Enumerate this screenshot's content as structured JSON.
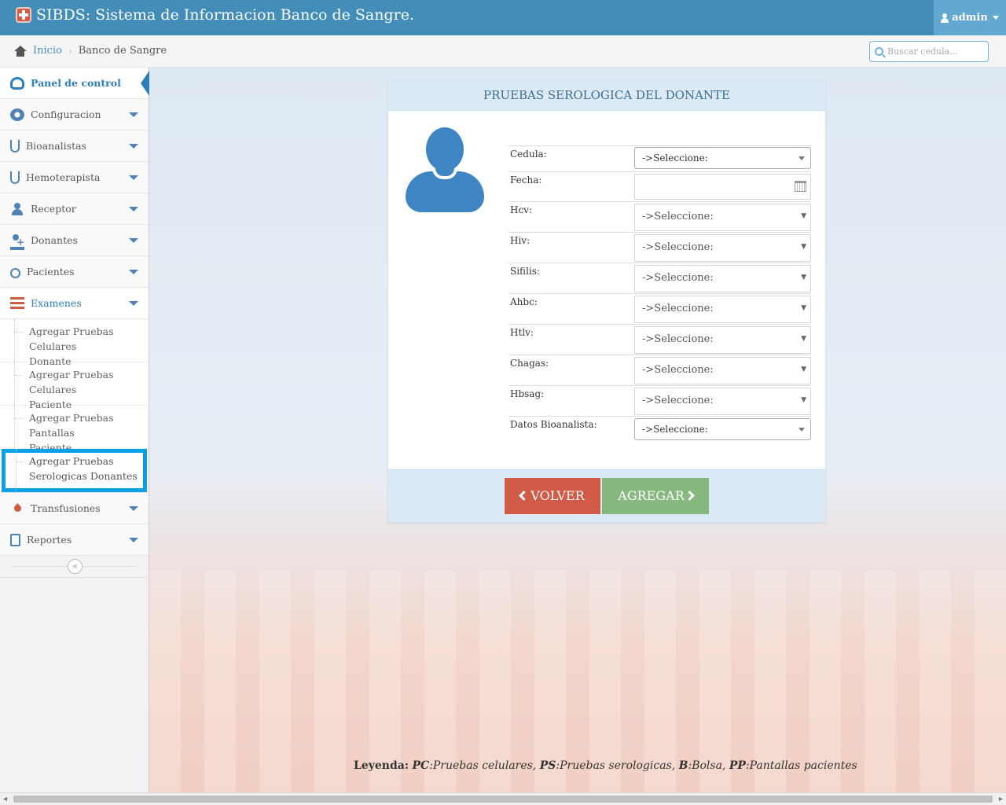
{
  "app": {
    "title": "SIBDS: Sistema de Informacion Banco de Sangre."
  },
  "user": {
    "name": "admin"
  },
  "breadcrumb": {
    "home": "Inicio",
    "current": "Banco de Sangre"
  },
  "search": {
    "placeholder": "Buscar cedula..."
  },
  "sidebar": {
    "items": [
      {
        "label": "Panel de control",
        "icon": "dashboard-icon"
      },
      {
        "label": "Configuracion",
        "icon": "gear-icon"
      },
      {
        "label": "Bioanalistas",
        "icon": "stethoscope-icon"
      },
      {
        "label": "Hemoterapista",
        "icon": "stethoscope-icon"
      },
      {
        "label": "Receptor",
        "icon": "user-icon"
      },
      {
        "label": "Donantes",
        "icon": "user-plus-icon"
      },
      {
        "label": "Pacientes",
        "icon": "wheelchair-icon"
      },
      {
        "label": "Examenes",
        "icon": "list-icon"
      },
      {
        "label": "Transfusiones",
        "icon": "drop-icon"
      },
      {
        "label": "Reportes",
        "icon": "pdf-icon"
      }
    ],
    "submenu": [
      {
        "line1": "Agregar Pruebas Celulares",
        "line2": "Donante"
      },
      {
        "line1": "Agregar Pruebas Celulares",
        "line2": "Paciente"
      },
      {
        "line1": "Agregar Pruebas Pantallas",
        "line2": "Paciente"
      },
      {
        "line1": "Agregar Pruebas",
        "line2": "Serologicas Donantes"
      }
    ],
    "collapse": "«"
  },
  "panel": {
    "title": "PRUEBAS SEROLOGICA DEL DONANTE",
    "fields": {
      "cedula": {
        "label": "Cedula:",
        "value": "->Seleccione:"
      },
      "fecha": {
        "label": "Fecha:",
        "value": ""
      },
      "hcv": {
        "label": "Hcv:",
        "value": "->Seleccione:"
      },
      "hiv": {
        "label": "Hiv:",
        "value": "->Seleccione:"
      },
      "sifilis": {
        "label": "Sifilis:",
        "value": "->Seleccione:"
      },
      "ahbc": {
        "label": "Ahbc:",
        "value": "->Seleccione:"
      },
      "htlv": {
        "label": "Htlv:",
        "value": "->Seleccione:"
      },
      "chagas": {
        "label": "Chagas:",
        "value": "->Seleccione:"
      },
      "hbsag": {
        "label": "Hbsag:",
        "value": "->Seleccione:"
      },
      "bioanalista": {
        "label": "Datos Bioanalista:",
        "value": "->Seleccione:"
      }
    },
    "buttons": {
      "back": "VOLVER",
      "add": "AGREGAR"
    }
  },
  "legend": {
    "title": "Leyenda:",
    "pc_code": "PC",
    "pc_text": ":Pruebas celulares,",
    "ps_code": "PS",
    "ps_text": ":Pruebas serologicas,",
    "b_code": "B",
    "b_text": ":Bolsa,",
    "pp_code": "PP",
    "pp_text": ":Pantallas pacientes"
  },
  "colors": {
    "navbar": "#438eb9",
    "accent": "#2b7dbc",
    "danger": "#d15b47",
    "success": "#87b87f",
    "highlight": "#0aa0e6"
  }
}
